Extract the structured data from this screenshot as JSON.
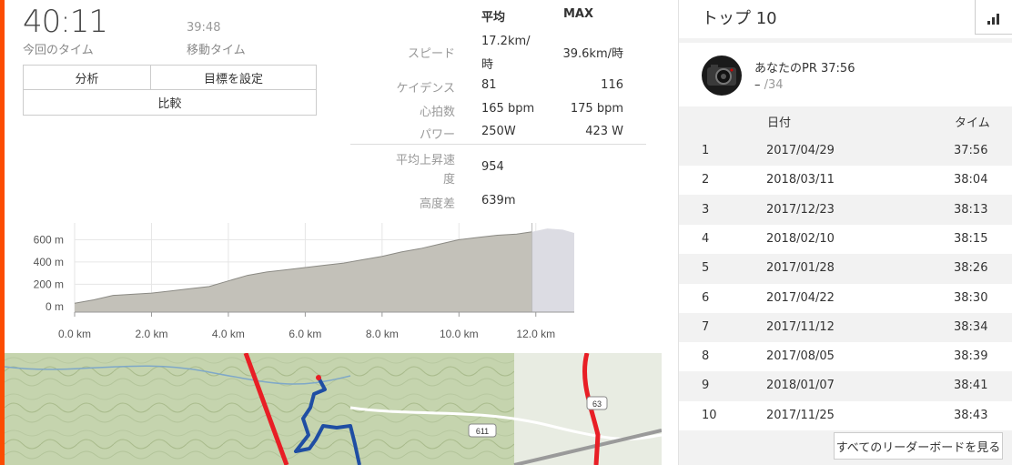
{
  "summary": {
    "elapsed_time": "40:11",
    "elapsed_label": "今回のタイム",
    "moving_time": "39:48",
    "moving_label": "移動タイム"
  },
  "buttons": {
    "analysis": "分析",
    "set_goal": "目標を設定",
    "compare": "比較"
  },
  "stats": {
    "head_avg": "平均",
    "head_max": "MAX",
    "rows": [
      {
        "label": "スピード",
        "avg_l1": "17.2km/",
        "avg_l2": "時",
        "max": "39.6km/時"
      },
      {
        "label": "ケイデンス",
        "avg": "81",
        "max": "116"
      },
      {
        "label": "心拍数",
        "avg": "165 bpm",
        "max": "175 bpm"
      },
      {
        "label": "パワー",
        "avg": "250W",
        "max": "423 W"
      }
    ],
    "climb_label_l1": "平均上昇速",
    "climb_label_l2": "度",
    "climb_value": "954",
    "elev_label": "高度差",
    "elev_value": "639m"
  },
  "chart_data": {
    "type": "area",
    "x": [
      0,
      0.5,
      1,
      1.5,
      2,
      2.5,
      3,
      3.5,
      4,
      4.5,
      5,
      5.5,
      6,
      6.5,
      7,
      7.5,
      8,
      8.5,
      9,
      9.5,
      10,
      10.5,
      11,
      11.5,
      11.9,
      12.3,
      12.7,
      13.0
    ],
    "y": [
      30,
      60,
      100,
      110,
      120,
      140,
      160,
      180,
      230,
      280,
      310,
      330,
      350,
      370,
      390,
      420,
      450,
      490,
      520,
      560,
      600,
      620,
      640,
      650,
      670,
      700,
      690,
      660
    ],
    "highlight_end": 11.9,
    "xlim": [
      0,
      13.0
    ],
    "ylim": [
      -50,
      750
    ],
    "x_ticks": [
      "0.0 km",
      "2.0 km",
      "4.0 km",
      "6.0 km",
      "8.0 km",
      "10.0 km",
      "12.0 km"
    ],
    "x_tick_values": [
      0,
      2,
      4,
      6,
      8,
      10,
      12
    ],
    "y_ticks": [
      "0 m",
      "200 m",
      "400 m",
      "600 m"
    ],
    "y_tick_values": [
      0,
      200,
      400,
      600
    ],
    "grid": true,
    "colors": {
      "fill": "#c3c1b9",
      "outline": "#8b8a84",
      "faded": "#dcdce3"
    }
  },
  "map": {
    "road_label_1": "611",
    "road_label_2": "63"
  },
  "leaderboard": {
    "title": "トップ 10",
    "pr_label": "あなたのPR 37:56",
    "pr_rank": "–",
    "pr_total": "/34",
    "col_date": "日付",
    "col_time": "タイム",
    "rows": [
      {
        "rank": "1",
        "date": "2017/04/29",
        "time": "37:56"
      },
      {
        "rank": "2",
        "date": "2018/03/11",
        "time": "38:04"
      },
      {
        "rank": "3",
        "date": "2017/12/23",
        "time": "38:13"
      },
      {
        "rank": "4",
        "date": "2018/02/10",
        "time": "38:15"
      },
      {
        "rank": "5",
        "date": "2017/01/28",
        "time": "38:26"
      },
      {
        "rank": "6",
        "date": "2017/04/22",
        "time": "38:30"
      },
      {
        "rank": "7",
        "date": "2017/11/12",
        "time": "38:34"
      },
      {
        "rank": "8",
        "date": "2017/08/05",
        "time": "38:39"
      },
      {
        "rank": "9",
        "date": "2018/01/07",
        "time": "38:41"
      },
      {
        "rank": "10",
        "date": "2017/11/25",
        "time": "38:43"
      }
    ],
    "view_all": "すべてのリーダーボードを見る"
  },
  "colors": {
    "accent": "#fc4c02",
    "route": "#1f4ea3",
    "road": "#e81e25"
  }
}
